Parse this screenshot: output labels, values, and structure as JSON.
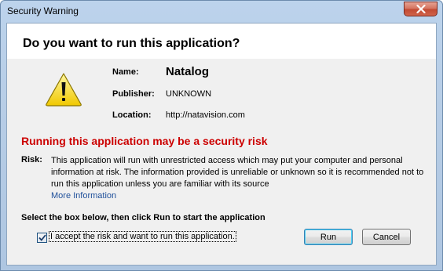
{
  "window": {
    "title": "Security Warning"
  },
  "header": {
    "question": "Do you want to run this application?"
  },
  "details": {
    "name_label": "Name:",
    "name_value": "Natalog",
    "publisher_label": "Publisher:",
    "publisher_value": "UNKNOWN",
    "location_label": "Location:",
    "location_value": "http://natavision.com"
  },
  "risk": {
    "heading": "Running this application may be a security risk",
    "label": "Risk:",
    "text": "This application will run with unrestricted access which may put your computer and personal information at risk. The information provided is unreliable or unknown so it is recommended not to run this application unless you are familiar with its source",
    "more_info": "More Information"
  },
  "consent": {
    "heading": "Select the box below, then click Run to start the application",
    "checkbox_label": "I accept the risk and want to run this application.",
    "checked": true
  },
  "buttons": {
    "run": "Run",
    "cancel": "Cancel"
  },
  "colors": {
    "risk_red": "#cc0000",
    "link_blue": "#1e4f9a",
    "warning_yellow": "#f5d400"
  },
  "icons": {
    "warning": "warning-triangle-icon",
    "close": "close-icon",
    "check": "checkmark-icon"
  }
}
